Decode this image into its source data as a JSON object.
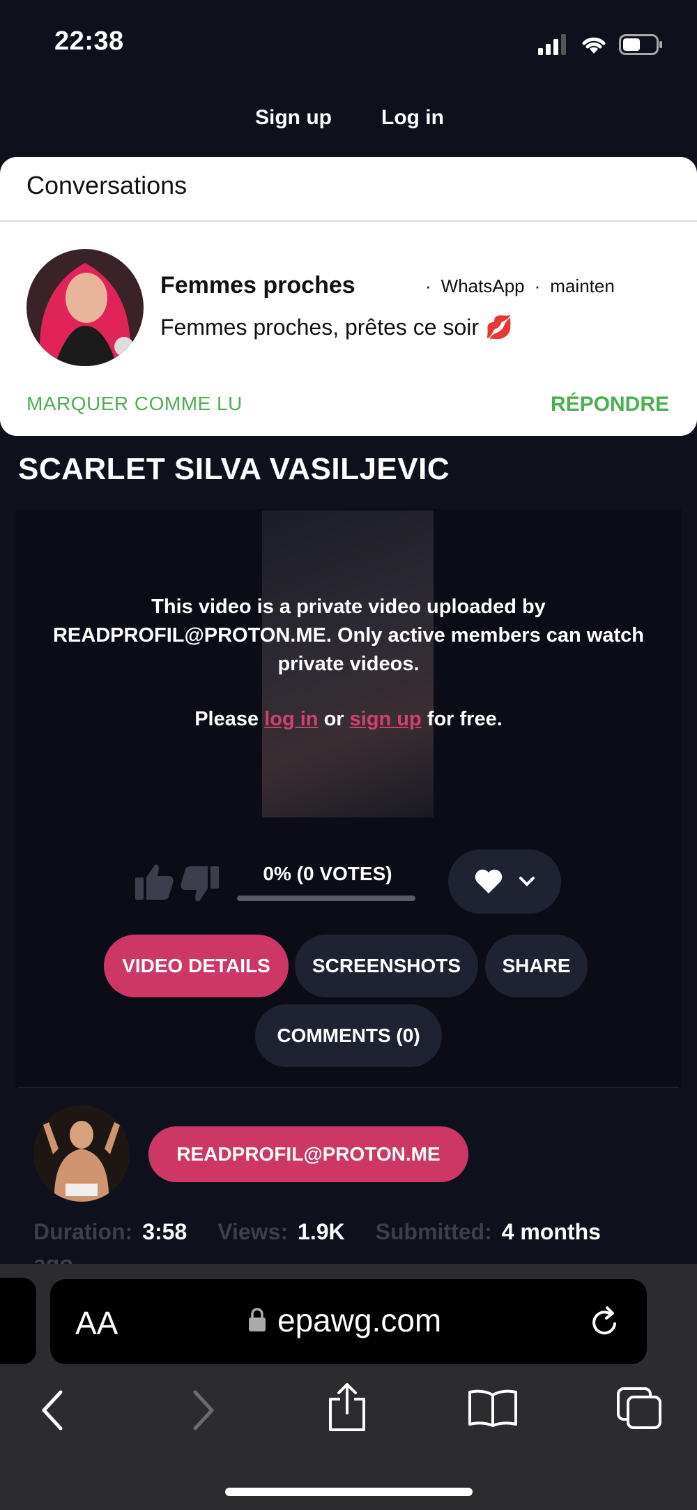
{
  "status_bar": {
    "time": "22:38"
  },
  "auth": {
    "signup": "Sign up",
    "login": "Log in"
  },
  "notification": {
    "header": "Conversations",
    "title": "Femmes proches",
    "source": "WhatsApp",
    "time": "mainten",
    "message": "Femmes proches, prêtes ce soir 💋",
    "mark_read": "MARQUER COMME LU",
    "reply": "RÉPONDRE"
  },
  "video": {
    "title": "SCARLET SILVA VASILJEVIC",
    "private_message": "This video is a private video uploaded by READPROFIL@PROTON.ME. Only active members can watch private videos.",
    "please_prefix": "Please",
    "login_link": "log in",
    "or_text": "or",
    "signup_link": "sign up",
    "please_suffix": "for free.",
    "rating_text": "0% (0 VOTES)",
    "rating_fraction": 0
  },
  "tabs": [
    {
      "label": "VIDEO DETAILS",
      "active": true
    },
    {
      "label": "SCREENSHOTS",
      "active": false
    },
    {
      "label": "SHARE",
      "active": false
    },
    {
      "label": "COMMENTS (0)",
      "active": false
    }
  ],
  "uploader": {
    "name": "READPROFIL@PROTON.ME"
  },
  "stats": {
    "duration_label": "Duration:",
    "duration": "3:58",
    "views_label": "Views:",
    "views": "1.9K",
    "submitted_label": "Submitted:",
    "submitted": "4 months",
    "submitted_wrap": "ago"
  },
  "browser": {
    "aa": "AA",
    "url": "epawg.com"
  },
  "colors": {
    "accent": "#cc3766",
    "notification_green": "#4caf50",
    "background": "#0e101b"
  }
}
